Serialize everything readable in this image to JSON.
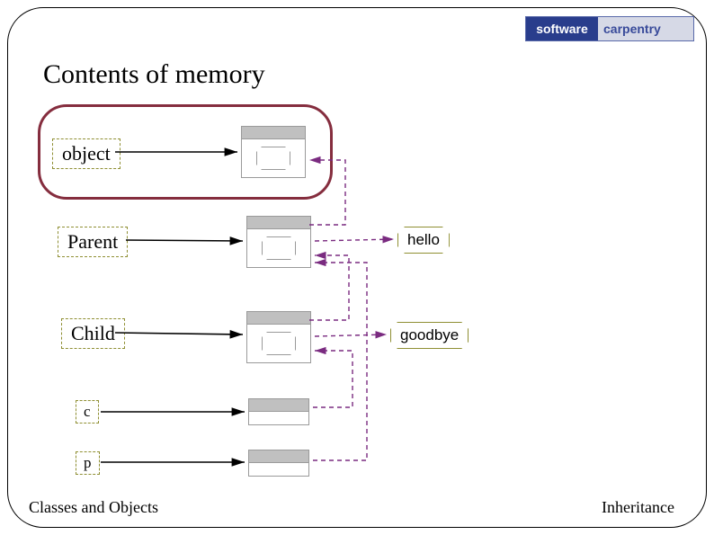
{
  "title": "Contents of memory",
  "logo": {
    "left": "software",
    "right": "carpentry"
  },
  "footer": {
    "left": "Classes and Objects",
    "right": "Inheritance"
  },
  "labels": {
    "object": "object",
    "parent": "Parent",
    "child": "Child",
    "c": "c",
    "p": "p"
  },
  "methods": {
    "hello": "hello",
    "goodbye": "goodbye"
  }
}
